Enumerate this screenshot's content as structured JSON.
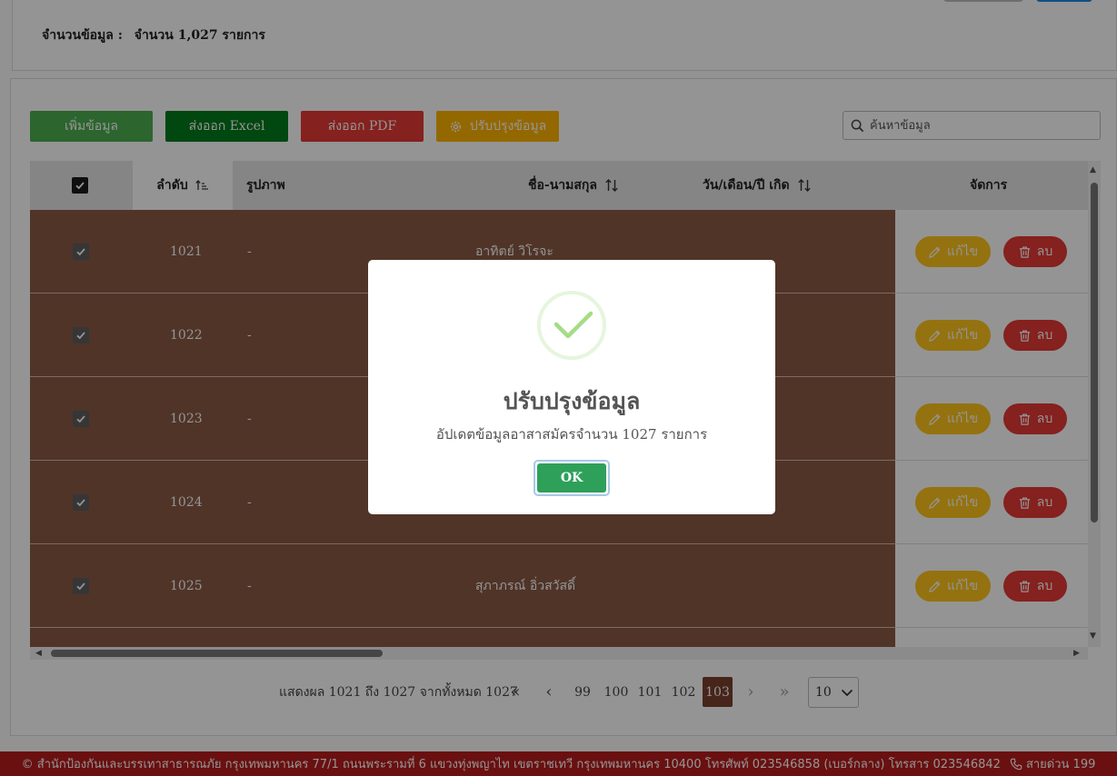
{
  "summary": {
    "label": "จำนวนข้อมูล :",
    "value": "จำนวน 1,027 รายการ"
  },
  "toolbar": {
    "add_label": "เพิ่มข้อมูล",
    "excel_label": "ส่งออก Excel",
    "pdf_label": "ส่งออก PDF",
    "refresh_label": "ปรับปรุงข้อมูล",
    "search_placeholder": "ค้นหาข้อมูล"
  },
  "table": {
    "headers": {
      "order": "ลำดับ",
      "photo": "รูปภาพ",
      "name": "ชื่อ-นามสกุล",
      "dob": "วัน/เดือน/ปี เกิด",
      "actions": "จัดการ"
    },
    "edit_label": "แก้ไข",
    "delete_label": "ลบ",
    "rows": [
      {
        "order": "1021",
        "photo": "-",
        "name": "อาทิตย์ วิโรจะ",
        "checked": true
      },
      {
        "order": "1022",
        "photo": "-",
        "name": "",
        "checked": true
      },
      {
        "order": "1023",
        "photo": "-",
        "name": "",
        "checked": true
      },
      {
        "order": "1024",
        "photo": "-",
        "name": "",
        "checked": true
      },
      {
        "order": "1025",
        "photo": "-",
        "name": "สุภาภรณ์ อิ่วสวัสดิ์",
        "checked": true
      }
    ]
  },
  "pagination": {
    "summary": "แสดงผล 1021 ถึง 1027 จากทั้งหมด 1027",
    "first": "«",
    "prev": "‹",
    "pages": [
      "99",
      "100",
      "101",
      "102",
      "103"
    ],
    "active_page": "103",
    "next": "›",
    "last": "»",
    "per_page": "10"
  },
  "footer": {
    "text": "© สำนักป้องกันและบรรเทาสาธารณภัย กรุงเทพมหานคร 77/1 ถนนพระรามที่ 6 แขวงทุ่งพญาไท เขตราชเทวี กรุงเทพมหานคร 10400 โทรศัพท์ 023546858 (เบอร์กลาง) โทรสาร 023546842",
    "hotline": "สายด่วน 199"
  },
  "dialog": {
    "title": "ปรับปรุงข้อมูล",
    "message": "อัปเดตข้อมูลอาสาสมัครจำนวน 1027 รายการ",
    "ok_label": "OK"
  },
  "colors": {
    "row_bg": "#8a5a45",
    "active_page": "#7a4130",
    "footer_bg": "#b71c1c",
    "ok_button": "#2ea05a",
    "success_check": "#a5dc86"
  },
  "icons": {
    "search": "search-icon",
    "gear": "gear-icon",
    "edit": "pencil-icon",
    "delete": "trash-icon",
    "sort": "sort-icon",
    "phone": "phone-icon",
    "success": "check-icon"
  }
}
